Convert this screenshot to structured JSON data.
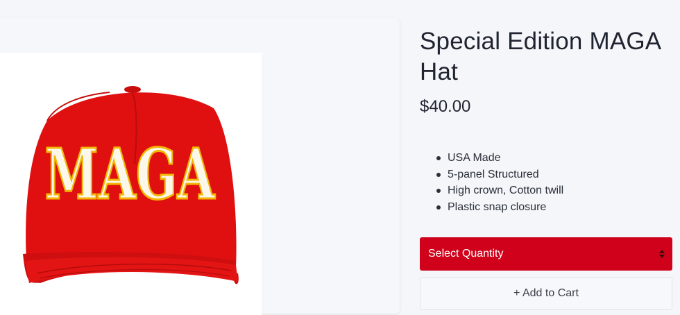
{
  "product": {
    "title": "Special Edition MAGA Hat",
    "price": "$40.00",
    "image": {
      "alt_icon": "red-cap-image",
      "cap_text": "MAGA",
      "cap_color": "#e01010",
      "letter_color": "#fbf7ea",
      "outline_color": "#f2b705"
    },
    "features": [
      "USA Made",
      "5-panel Structured",
      "High crown, Cotton twill",
      "Plastic snap closure"
    ]
  },
  "purchase": {
    "quantity_select_label": "Select Quantity",
    "add_to_cart_label": "+ Add to Cart"
  },
  "colors": {
    "accent": "#d0021b",
    "background": "#f4f6f9"
  }
}
